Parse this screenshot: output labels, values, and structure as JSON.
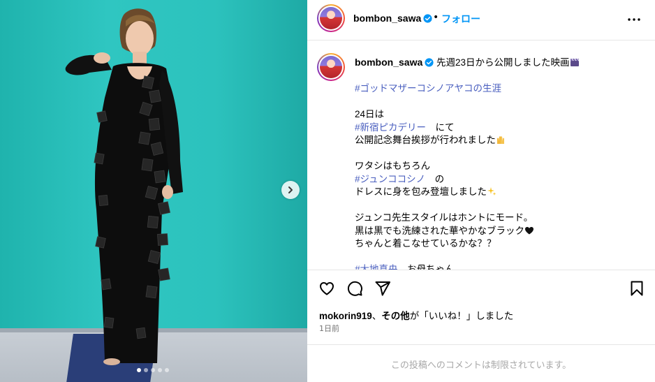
{
  "post": {
    "username": "bombon_sawa",
    "dot": "•",
    "follow_label": "フォロー",
    "caption_lines": [
      {
        "text": "先週23日から公開しました映画",
        "emoji": "clapper"
      },
      {
        "gap": true
      },
      {
        "tag": "#ゴッドマザーコシノアヤコの生涯"
      },
      {
        "gap": true
      },
      {
        "text": "24日は"
      },
      {
        "tag": "#新宿ピカデリー",
        "after": "　にて"
      },
      {
        "text": "公開記念舞台挨拶が行われました",
        "emoji": "raised-hands"
      },
      {
        "gap": true
      },
      {
        "text": "ワタシはもちろん"
      },
      {
        "tag": "#ジュンココシノ",
        "after": "　の"
      },
      {
        "text": "ドレスに身を包み登壇しました",
        "emoji": "sparkles"
      },
      {
        "gap": true
      },
      {
        "text": "ジュンコ先生スタイルはホントにモード。"
      },
      {
        "text": "黒は黒でも洗練された華やかなブラック",
        "emoji": "black-heart"
      },
      {
        "text": "ちゃんと着こなせているかな？？"
      },
      {
        "gap": true
      },
      {
        "tag": "#大地真央",
        "after": "　お母ちゃん、"
      }
    ],
    "likes": {
      "user": "mokorin919",
      "sep": "、",
      "others": "その他",
      "suffix": "が「いいね！」しました"
    },
    "time": "1日前",
    "comments_limited": "この投稿へのコメントは制限されています。"
  },
  "carousel": {
    "count": 5,
    "active": 0
  },
  "icons": {
    "verified": "verified-badge-icon",
    "more": "more-horizontal-icon",
    "next": "chevron-right-icon",
    "like": "heart-icon",
    "comment": "comment-icon",
    "share": "share-icon",
    "save": "bookmark-icon"
  },
  "colors": {
    "accent": "#0095f6",
    "hashtag": "#4a5fbf",
    "muted": "#737373",
    "wall": "#2cc2bd"
  }
}
